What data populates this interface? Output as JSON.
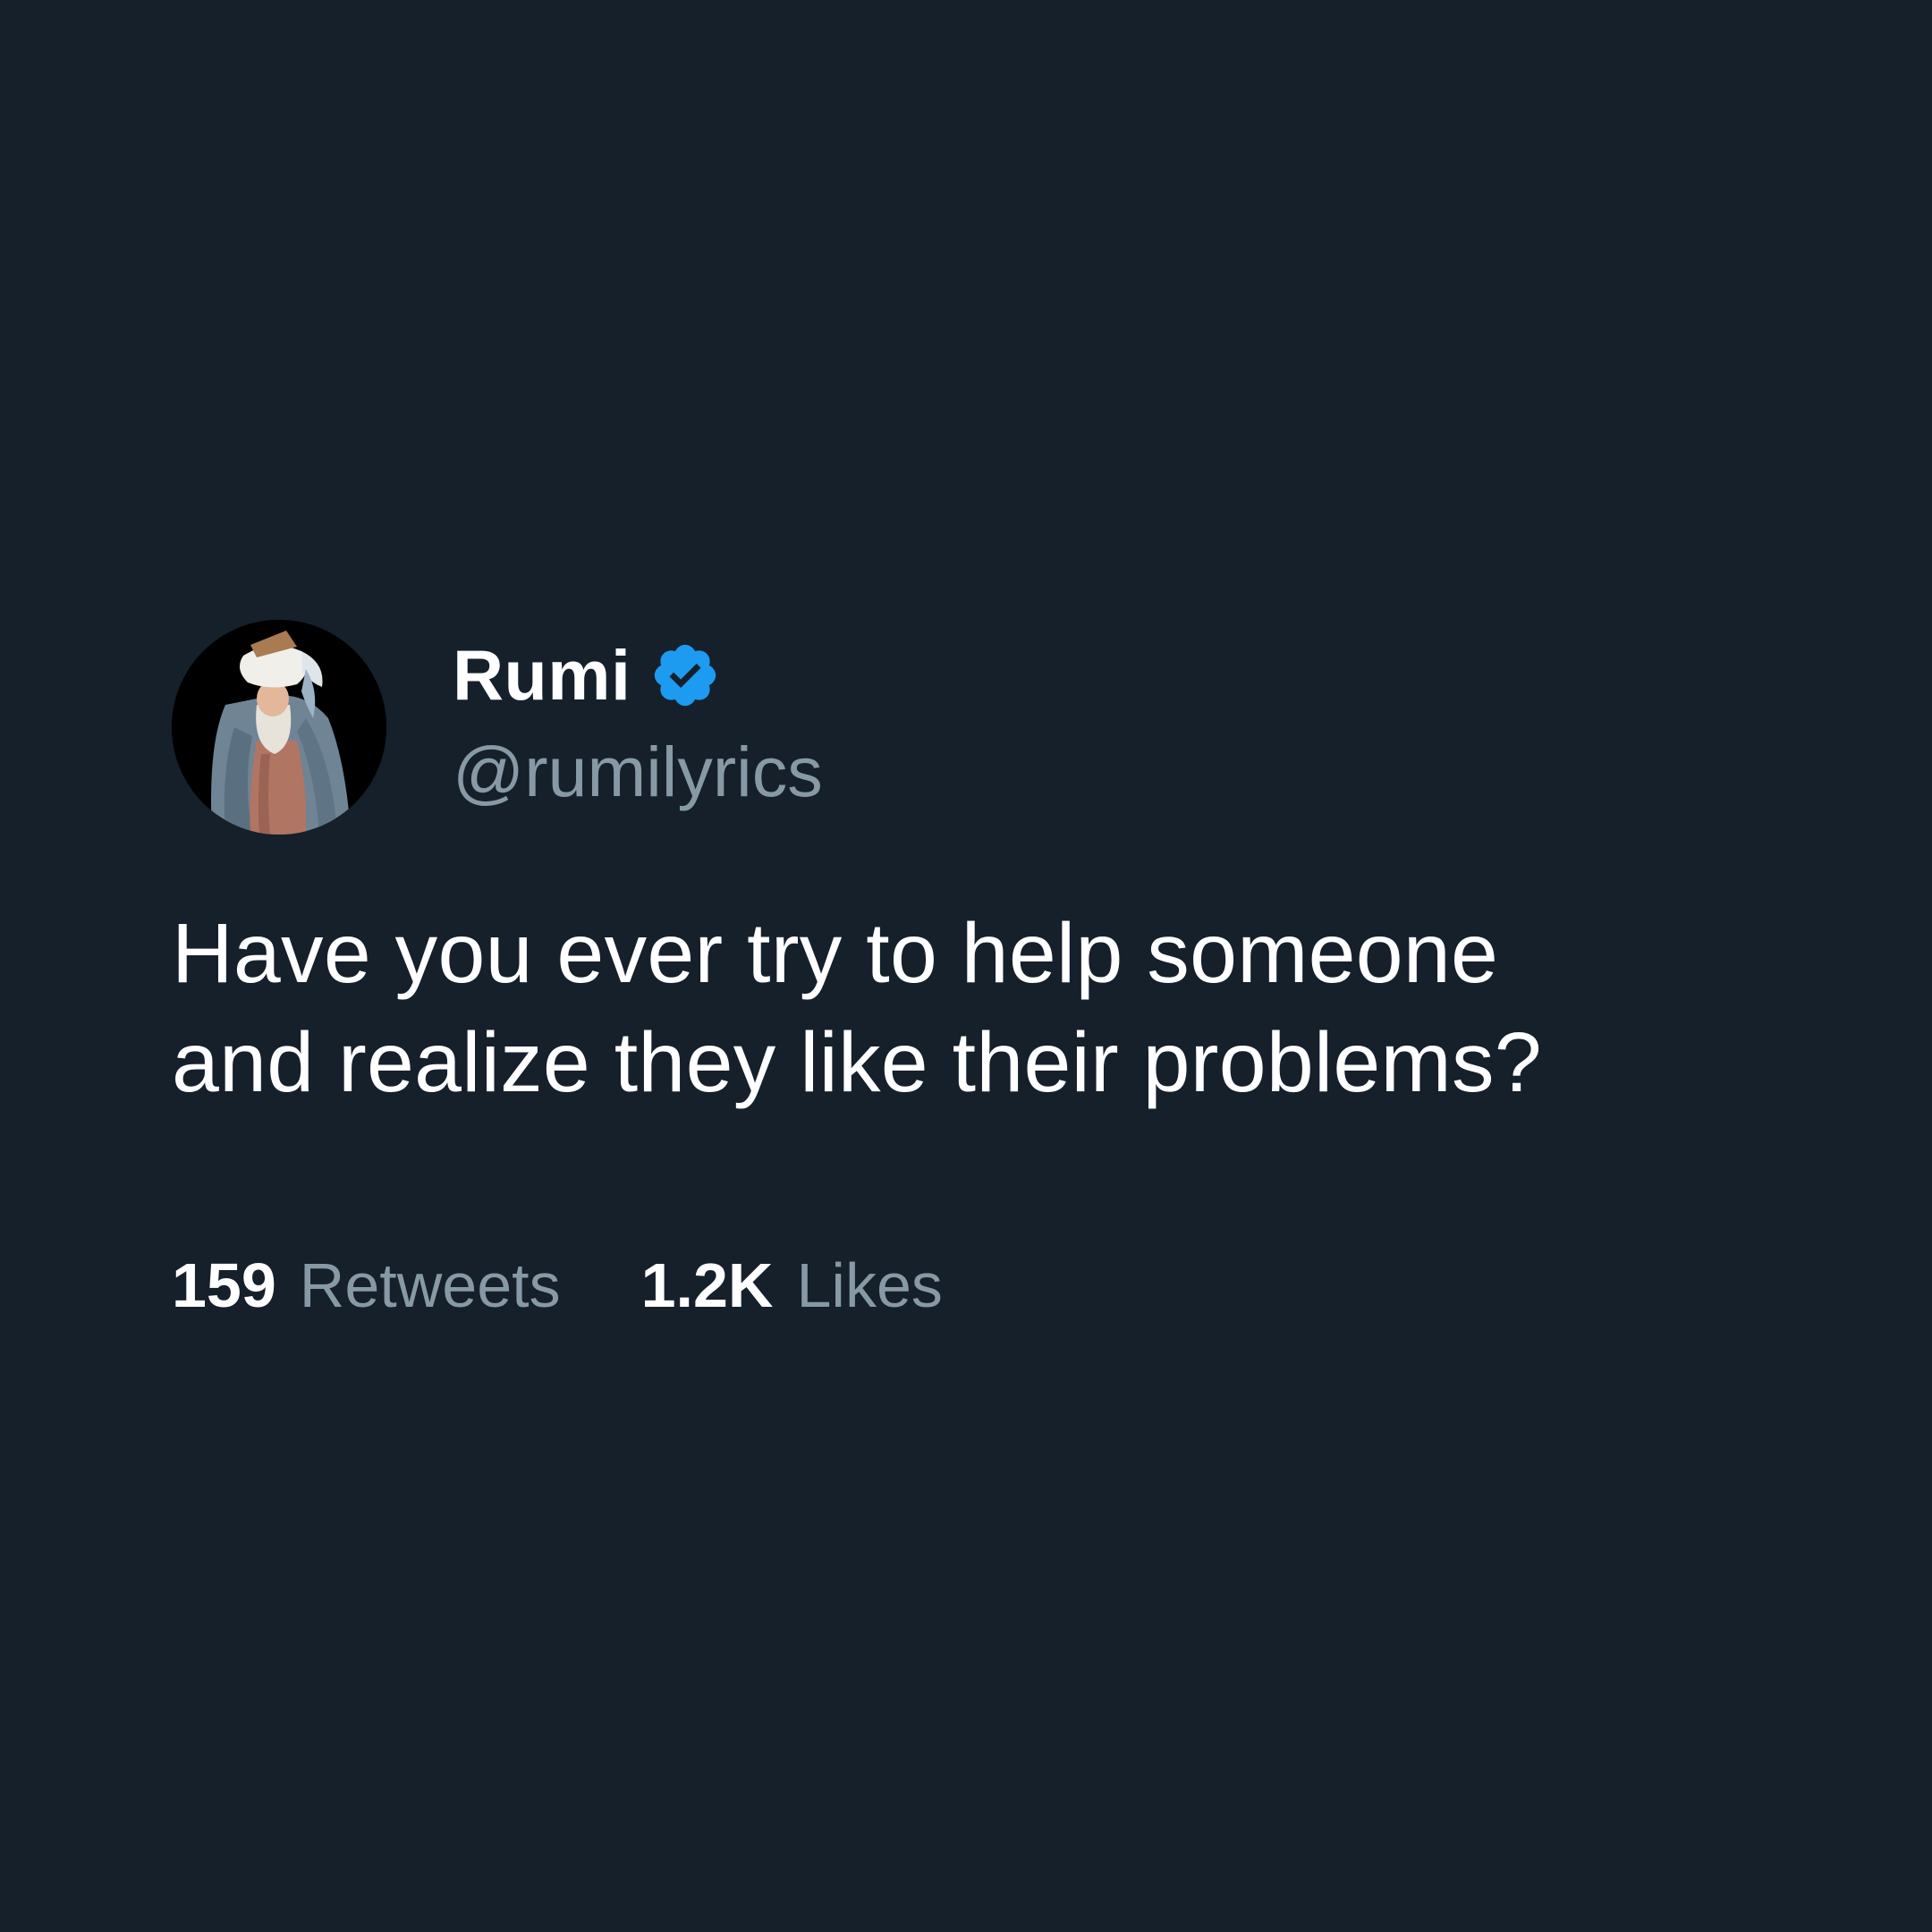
{
  "tweet": {
    "display_name": "Rumi",
    "handle": "@rumilyrics",
    "verified": true,
    "text": "Have you ever try to help someone\nand realize they like their problems?",
    "avatar_icon": "portrait-avatar"
  },
  "stats": {
    "retweets_count": "159",
    "retweets_label": "Retweets",
    "likes_count": "1.2K",
    "likes_label": "Likes"
  },
  "colors": {
    "background": "#15202b",
    "primary_text": "#ffffff",
    "secondary_text": "#8899a6",
    "verified_badge": "#1d9bf0"
  }
}
